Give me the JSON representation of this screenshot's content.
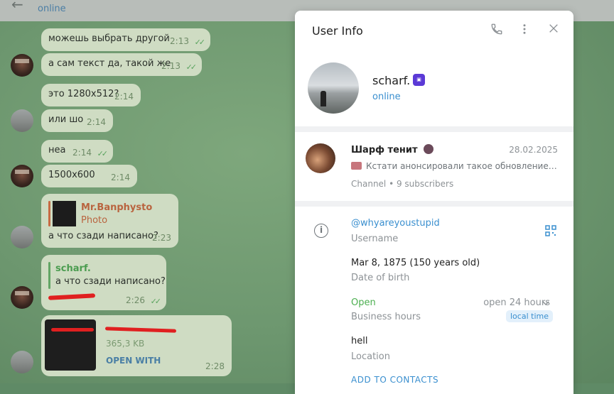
{
  "chat": {
    "header_status": "online",
    "messages": [
      {
        "text": "можешь выбрать другой",
        "time": "2:13"
      },
      {
        "text": "а сам текст да, такой же",
        "time": "2:13"
      },
      {
        "text": "это 1280x512?",
        "time": "2:14"
      },
      {
        "text": "или шо",
        "time": "2:14"
      },
      {
        "text": "неа",
        "time": "2:14"
      },
      {
        "text": "1500x600",
        "time": "2:14"
      },
      {
        "reply_author": "Mr.Banphysto",
        "reply_text": "Photo",
        "text": "а что сзади написано?",
        "time": "2:23"
      },
      {
        "reply_author": "scharf.",
        "reply_text": "а что сзади написано?",
        "time": "2:26"
      },
      {
        "file_size": "365,3 KB",
        "action": "OPEN WITH",
        "time": "2:28"
      }
    ]
  },
  "panel": {
    "title": "User Info",
    "profile": {
      "name": "scharf.",
      "status": "online"
    },
    "channel": {
      "name": "Шарф тенит",
      "date": "28.02.2025",
      "preview": "Кстати анонсировали такое обновление, …",
      "meta": "Channel • 9 subscribers"
    },
    "info": {
      "username_value": "@whyareyoustupid",
      "username_label": "Username",
      "dob_value": "Mar 8, 1875 (150 years old)",
      "dob_label": "Date of birth",
      "hours_value": "Open",
      "hours_label": "Business hours",
      "hours_right": "open 24 hours",
      "hours_tz": "local time",
      "location_value": "hell",
      "location_label": "Location",
      "add_contact": "ADD TO CONTACTS"
    }
  }
}
